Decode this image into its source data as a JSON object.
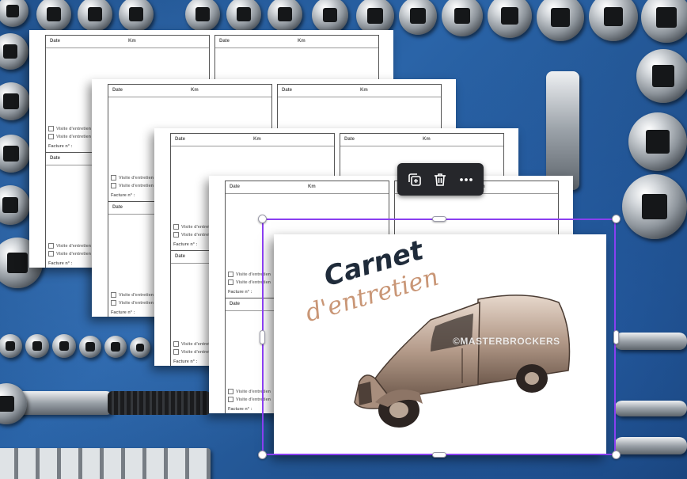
{
  "document": {
    "cell_labels": {
      "date": "Date",
      "km": "Km"
    },
    "checkbox_label": "Visite d'entretien",
    "invoice_label": "Facture n° :"
  },
  "cover": {
    "title": "Carnet",
    "subtitle": "d'entretien",
    "watermark": "©MASTERBROCKERS",
    "title_color": "#1f2b3a",
    "subtitle_color": "#c99676"
  },
  "toolbar": {
    "items": [
      {
        "name": "duplicate-button",
        "icon": "duplicate-icon"
      },
      {
        "name": "delete-button",
        "icon": "trash-icon"
      },
      {
        "name": "more-options-button",
        "icon": "more-horizontal-icon"
      }
    ]
  },
  "selection": {
    "color": "#8a3ff0"
  }
}
